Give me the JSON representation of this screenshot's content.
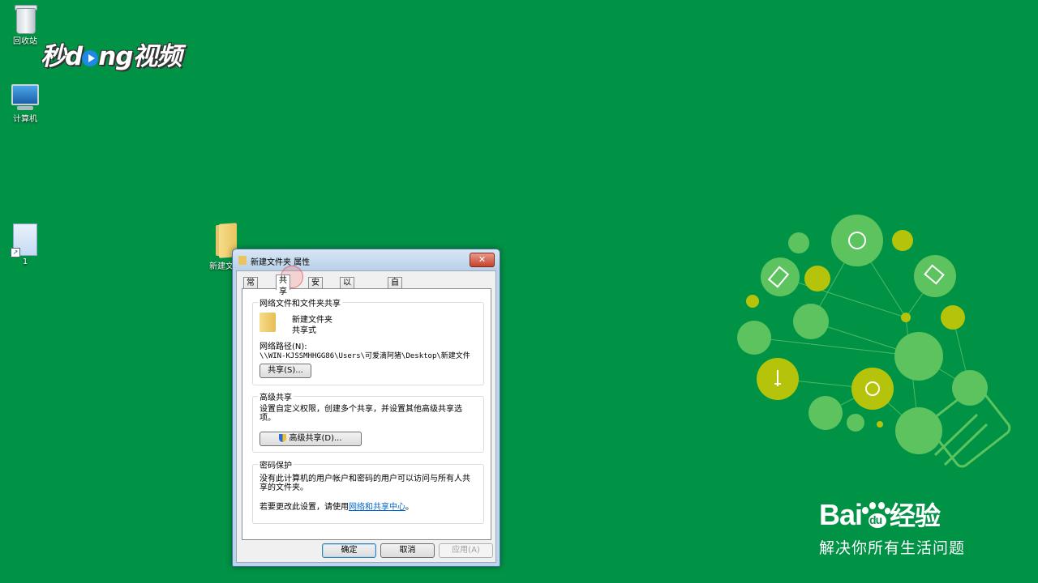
{
  "desktop": {
    "icons": [
      {
        "label": "回收站"
      },
      {
        "label": "计算机"
      },
      {
        "label": "1"
      },
      {
        "label": "新建文"
      }
    ],
    "brand": {
      "text_a": "秒d",
      "text_b": "ng视频"
    },
    "watermark": {
      "brand_a": "Bai",
      "brand_b": "du",
      "brand_c": "经验",
      "tagline": "解决你所有生活问题"
    }
  },
  "dialog": {
    "title": "新建文件夹 属性",
    "close": "✕",
    "tabs": [
      "常规",
      "共享",
      "安全",
      "以前的版本",
      "自定义"
    ],
    "active_tab": "共享",
    "network_sharing": {
      "legend": "网络文件和文件夹共享",
      "folder_name": "新建文件夹",
      "status": "共享式",
      "path_label": "网络路径(N):",
      "path_value": "\\\\WIN-KJSSMHHGG86\\Users\\可爱滴阿猪\\Desktop\\新建文件",
      "share_button": "共享(S)..."
    },
    "advanced": {
      "legend": "高级共享",
      "description": "设置自定义权限，创建多个共享，并设置其他高级共享选项。",
      "button": "高级共享(D)..."
    },
    "password": {
      "legend": "密码保护",
      "description": "没有此计算机的用户帐户和密码的用户可以访问与所有人共享的文件夹。",
      "change_prefix": "若要更改此设置，请使用",
      "change_link": "网络和共享中心",
      "change_suffix": "。"
    },
    "buttons": {
      "ok": "确定",
      "cancel": "取消",
      "apply": "应用(A)"
    }
  },
  "colors": {
    "desktop": "#009345",
    "bulb_light": "#5cc35e",
    "bulb_yellow": "#b5c40a"
  }
}
